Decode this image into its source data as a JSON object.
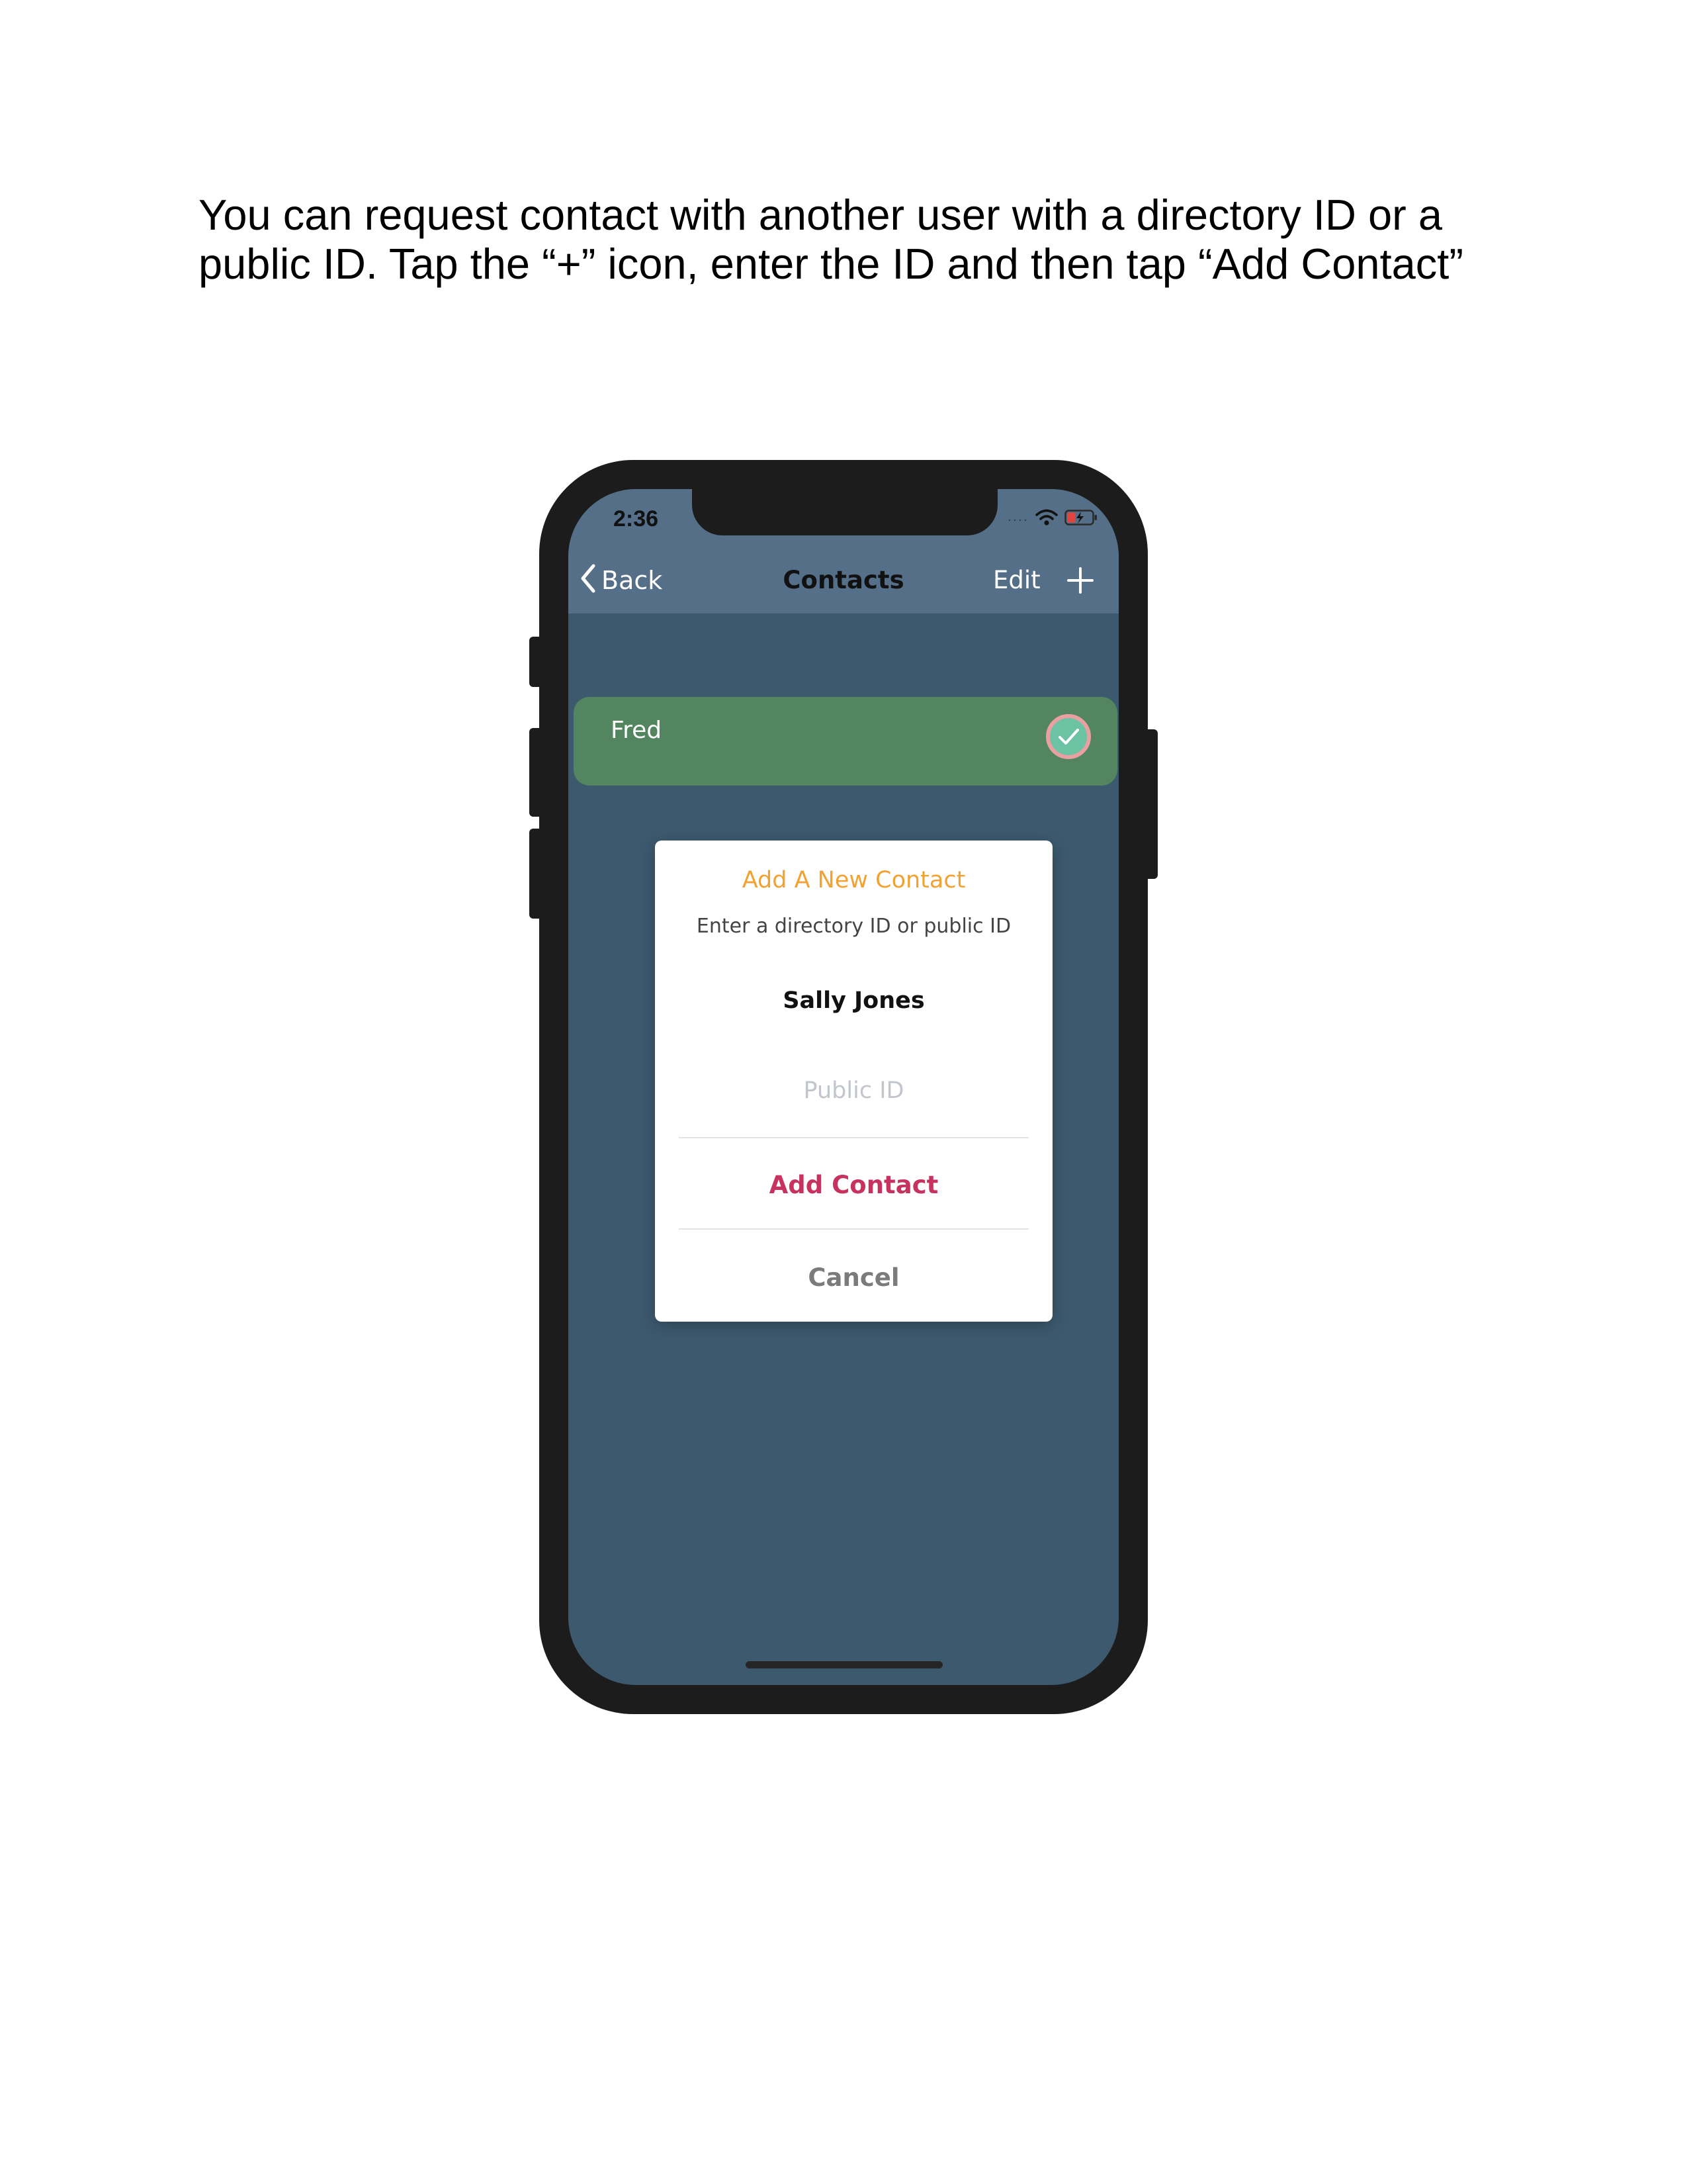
{
  "instructions": "You can request contact with another user with a directory ID or a public ID. Tap the “+” icon, enter the ID and then tap “Add Contact”",
  "status_bar": {
    "time": "2:36",
    "icons": [
      "signal-icon",
      "wifi-icon",
      "battery-icon"
    ]
  },
  "navbar": {
    "back_label": "Back",
    "title": "Contacts",
    "edit_label": "Edit",
    "add_icon": "plus-icon"
  },
  "contacts": [
    {
      "name": "Fred",
      "status_icon": "check-circle-icon"
    }
  ],
  "dialog": {
    "title": "Add A New Contact",
    "subtitle": "Enter a directory ID or public ID",
    "directory_id_value": "Sally Jones",
    "public_id_placeholder": "Public ID",
    "add_button_label": "Add Contact",
    "cancel_button_label": "Cancel"
  },
  "colors": {
    "navbar_bg": "#546f87",
    "screen_bg": "#3d596e",
    "contact_row_bg": "#528560",
    "dialog_title": "#f2a233",
    "add_button": "#c7325f",
    "cancel_button": "#7b7b7b",
    "battery_red": "#e0443e",
    "check_fill": "#6cc3a4",
    "check_ring": "#e8a0a0"
  }
}
